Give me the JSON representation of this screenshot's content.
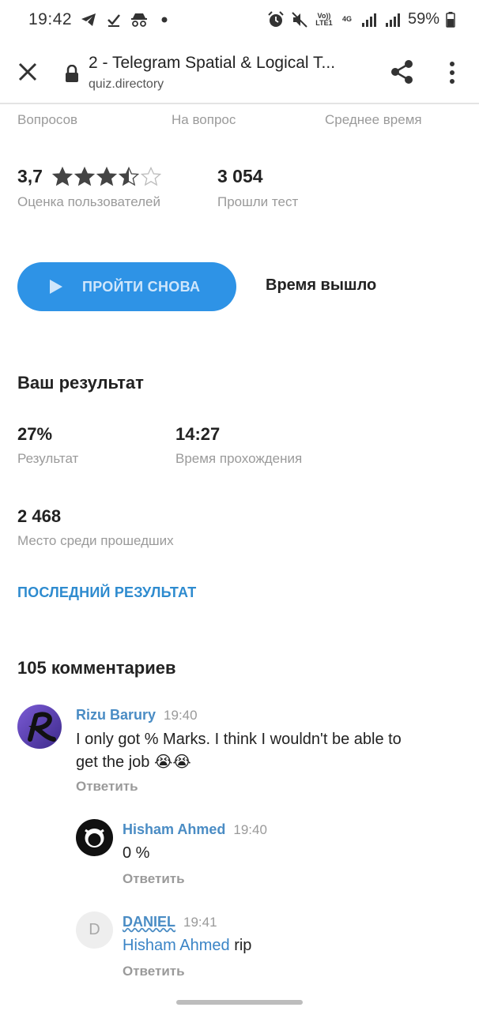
{
  "status_bar": {
    "time": "19:42",
    "network_top": "Vo))",
    "network_bottom": "LTE1",
    "data_type": "4G",
    "battery": "59%"
  },
  "browser": {
    "title": "2 - Telegram Spatial & Logical T...",
    "url": "quiz.directory"
  },
  "stats": {
    "labels": [
      "Вопросов",
      "На вопрос",
      "Среднее время"
    ],
    "rating_value": "3,7",
    "rating_stars": 3.5,
    "rating_label": "Оценка пользователей",
    "passed_value": "3 054",
    "passed_label": "Прошли тест"
  },
  "actions": {
    "retry_label": "ПРОЙТИ СНОВА",
    "time_over": "Время вышло"
  },
  "result": {
    "heading": "Ваш результат",
    "score_value": "27%",
    "score_label": "Результат",
    "time_value": "14:27",
    "time_label": "Время прохождения",
    "place_value": "2 468",
    "place_label": "Место среди прошедших",
    "last_result_link": "ПОСЛЕДНИЙ РЕЗУЛЬТАТ"
  },
  "comments": {
    "heading": "105 комментариев",
    "reply_label": "Ответить",
    "items": [
      {
        "author": "Rizu Barury",
        "time": "19:40",
        "text_line1": "I only got % Marks. I think I wouldn't be able to",
        "text_line2": "get the job 😭😭"
      },
      {
        "author": "Hisham Ahmed",
        "time": "19:40",
        "text": "0 %"
      },
      {
        "author": "DANIEL",
        "avatar_letter": "D",
        "time": "19:41",
        "mention": "Hisham Ahmed",
        "text": "rip"
      }
    ]
  },
  "colors": {
    "accent": "#2e93e6",
    "link": "#2e8bcf",
    "name": "#4a8cc4",
    "muted": "#9a9a9a"
  }
}
